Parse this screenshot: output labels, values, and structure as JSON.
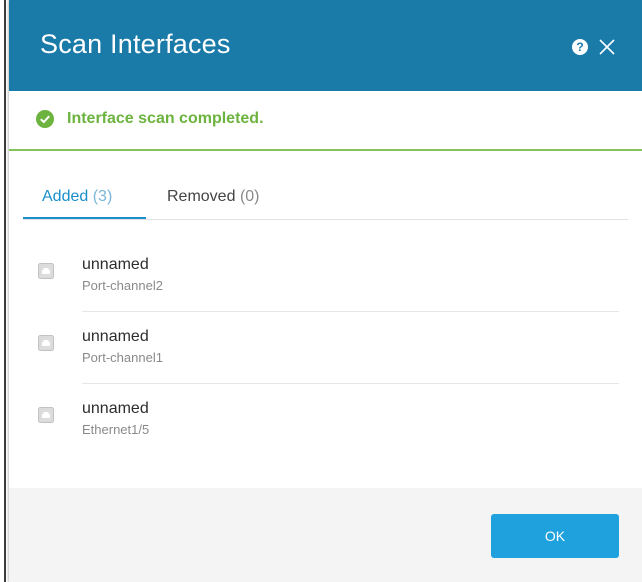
{
  "dialog": {
    "title": "Scan Interfaces",
    "help_icon": "question-circle-icon",
    "close_icon": "close-icon"
  },
  "status": {
    "icon": "check-circle-icon",
    "message": "Interface scan completed.",
    "color": "#6db33f"
  },
  "tabs": [
    {
      "label": "Added",
      "count": "(3)",
      "active": true
    },
    {
      "label": "Removed",
      "count": "(0)",
      "active": false
    }
  ],
  "interfaces": [
    {
      "name": "unnamed",
      "port": "Port-channel2",
      "icon": "ethernet-port-icon"
    },
    {
      "name": "unnamed",
      "port": "Port-channel1",
      "icon": "ethernet-port-icon"
    },
    {
      "name": "unnamed",
      "port": "Ethernet1/5",
      "icon": "ethernet-port-icon"
    }
  ],
  "footer": {
    "ok_label": "OK"
  },
  "colors": {
    "header": "#1a7aa8",
    "accent": "#1a8fcb",
    "button": "#1ea1dc",
    "success": "#6db33f"
  }
}
